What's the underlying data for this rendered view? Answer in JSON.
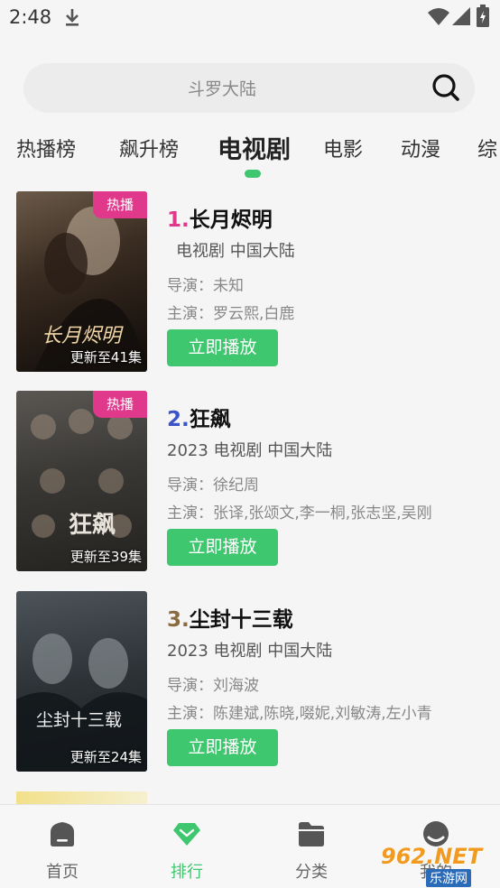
{
  "status": {
    "time": "2:48"
  },
  "search": {
    "placeholder": "斗罗大陆"
  },
  "tabs": [
    {
      "label": "热播榜"
    },
    {
      "label": "飙升榜"
    },
    {
      "label": "电视剧",
      "active": true
    },
    {
      "label": "电影"
    },
    {
      "label": "动漫"
    },
    {
      "label": "综"
    }
  ],
  "items": [
    {
      "rank": "1.",
      "title": "长月烬明",
      "badge": "热播",
      "episodes": "更新至41集",
      "meta": "电视剧  中国大陆",
      "director": "导演：未知",
      "cast": "主演：罗云熙,白鹿",
      "play_label": "立即播放",
      "poster_text": "长月烬明"
    },
    {
      "rank": "2.",
      "title": "狂飙",
      "badge": "热播",
      "episodes": "更新至39集",
      "meta": "2023  电视剧  中国大陆",
      "director": "导演：徐纪周",
      "cast": "主演：张译,张颂文,李一桐,张志坚,吴刚",
      "play_label": "立即播放",
      "poster_text": "狂飙"
    },
    {
      "rank": "3.",
      "title": "尘封十三载",
      "episodes": "更新至24集",
      "meta": "2023  电视剧  中国大陆",
      "director": "导演：刘海波",
      "cast": "主演：陈建斌,陈晓,啜妮,刘敏涛,左小青",
      "play_label": "立即播放",
      "poster_text": "尘封十三载"
    }
  ],
  "bottom_nav": [
    {
      "label": "首页",
      "icon": "home-icon"
    },
    {
      "label": "排行",
      "icon": "diamond-icon",
      "active": true
    },
    {
      "label": "分类",
      "icon": "folder-icon"
    },
    {
      "label": "我的",
      "icon": "profile-icon"
    }
  ],
  "watermark": {
    "brand": "962.NET",
    "sub": "乐游网"
  },
  "colors": {
    "accent": "#3ec76f",
    "badge": "#e0388a",
    "rank1": "#e0388a",
    "rank2": "#3d54c9",
    "rank3": "#8a6a3f"
  }
}
